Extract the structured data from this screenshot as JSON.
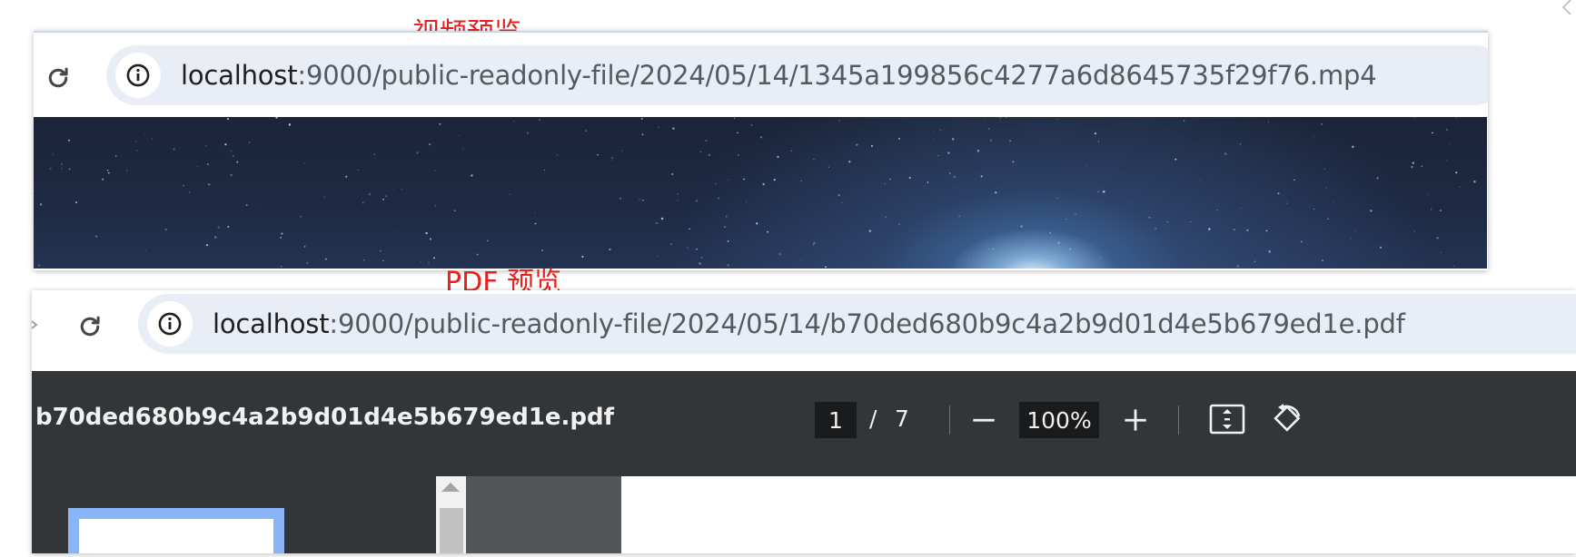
{
  "captions": {
    "video": "视频预览",
    "pdf": "PDF 预览"
  },
  "video_panel": {
    "url_host": "localhost",
    "url_rest": ":9000/public-readonly-file/2024/05/14/1345a199856c4277a6d8645735f29f76.mp4"
  },
  "pdf_panel": {
    "url_host": "localhost",
    "url_rest": ":9000/public-readonly-file/2024/05/14/b70ded680b9c4a2b9d01d4e5b679ed1e.pdf",
    "toolbar": {
      "file_name": "b70ded680b9c4a2b9d01d4e5b679ed1e.pdf",
      "current_page": "1",
      "page_separator": "/",
      "total_pages": "7",
      "zoom": "100%"
    }
  },
  "icons": {
    "reload": "reload-icon",
    "site_info": "info-icon",
    "zoom_out": "minus-icon",
    "zoom_in": "plus-icon",
    "fit": "fit-to-page-icon",
    "rotate": "rotate-icon"
  },
  "colors": {
    "caption": "#e8211e",
    "omnibox": "#e9edf6",
    "pdf_toolbar": "#323639",
    "thumbnail_highlight": "#8ab4f8"
  }
}
